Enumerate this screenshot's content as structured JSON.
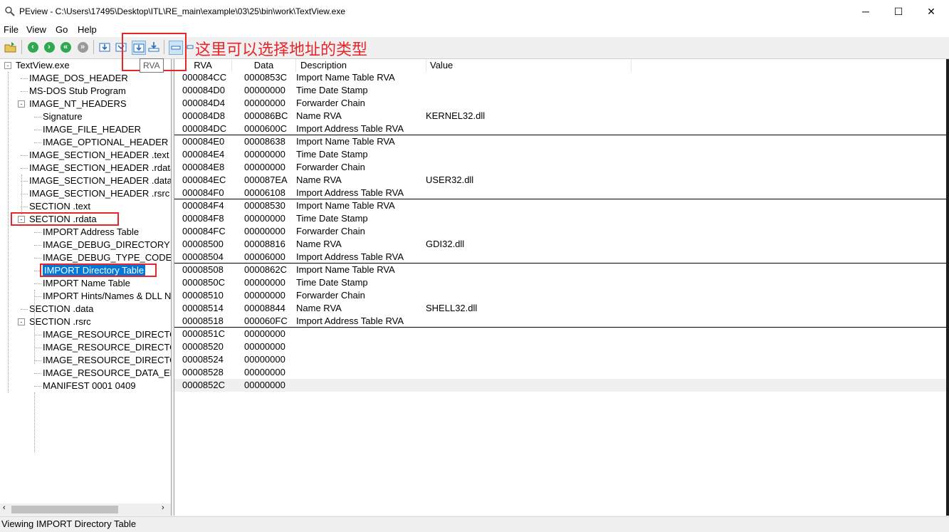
{
  "window": {
    "title": "PEview - C:\\Users\\17495\\Desktop\\ITL\\RE_main\\example\\03\\25\\bin\\work\\TextView.exe",
    "minimize": "─",
    "maximize": "☐",
    "close": "✕"
  },
  "menu": [
    "File",
    "View",
    "Go",
    "Help"
  ],
  "toolbar": {
    "tooltip": "RVA",
    "icons": [
      "open-file-icon",
      "back-icon",
      "forward-icon",
      "up-icon",
      "down-icon",
      "view-raw-icon",
      "view-rva-icon",
      "view-rva-selected-icon",
      "view-va-icon",
      "toolbar-option-icon"
    ]
  },
  "annotation": {
    "text": "这里可以选择地址的类型"
  },
  "tree": {
    "nodes": [
      {
        "label": "TextView.exe",
        "depth": 0,
        "expander": "-"
      },
      {
        "label": "IMAGE_DOS_HEADER",
        "depth": 1
      },
      {
        "label": "MS-DOS Stub Program",
        "depth": 1
      },
      {
        "label": "IMAGE_NT_HEADERS",
        "depth": 1,
        "expander": "-"
      },
      {
        "label": "Signature",
        "depth": 2
      },
      {
        "label": "IMAGE_FILE_HEADER",
        "depth": 2
      },
      {
        "label": "IMAGE_OPTIONAL_HEADER",
        "depth": 2
      },
      {
        "label": "IMAGE_SECTION_HEADER .text",
        "depth": 1
      },
      {
        "label": "IMAGE_SECTION_HEADER .rdata",
        "depth": 1
      },
      {
        "label": "IMAGE_SECTION_HEADER .data",
        "depth": 1
      },
      {
        "label": "IMAGE_SECTION_HEADER .rsrc",
        "depth": 1
      },
      {
        "label": "SECTION .text",
        "depth": 1
      },
      {
        "label": "SECTION .rdata",
        "depth": 1,
        "expander": "-"
      },
      {
        "label": "IMPORT Address Table",
        "depth": 2
      },
      {
        "label": "IMAGE_DEBUG_DIRECTORY",
        "depth": 2
      },
      {
        "label": "IMAGE_DEBUG_TYPE_CODEVIEW",
        "depth": 2
      },
      {
        "label": "IMPORT Directory Table",
        "depth": 2,
        "selected": true
      },
      {
        "label": "IMPORT Name Table",
        "depth": 2
      },
      {
        "label": "IMPORT Hints/Names & DLL Names",
        "depth": 2
      },
      {
        "label": "SECTION .data",
        "depth": 1
      },
      {
        "label": "SECTION .rsrc",
        "depth": 1,
        "expander": "-"
      },
      {
        "label": "IMAGE_RESOURCE_DIRECTORY Type",
        "depth": 2
      },
      {
        "label": "IMAGE_RESOURCE_DIRECTORY NameID",
        "depth": 2
      },
      {
        "label": "IMAGE_RESOURCE_DIRECTORY Language",
        "depth": 2
      },
      {
        "label": "IMAGE_RESOURCE_DATA_ENTRY",
        "depth": 2
      },
      {
        "label": "MANIFEST  0001  0409",
        "depth": 2
      }
    ]
  },
  "list": {
    "columns": [
      "RVA",
      "Data",
      "Description",
      "Value"
    ],
    "rows": [
      {
        "rva": "000084CC",
        "data": "0000853C",
        "desc": "Import Name Table RVA",
        "value": ""
      },
      {
        "rva": "000084D0",
        "data": "00000000",
        "desc": "Time Date Stamp",
        "value": ""
      },
      {
        "rva": "000084D4",
        "data": "00000000",
        "desc": "Forwarder Chain",
        "value": ""
      },
      {
        "rva": "000084D8",
        "data": "000086BC",
        "desc": "Name RVA",
        "value": "KERNEL32.dll"
      },
      {
        "rva": "000084DC",
        "data": "0000600C",
        "desc": "Import Address Table RVA",
        "value": "",
        "sep": true
      },
      {
        "rva": "000084E0",
        "data": "00008638",
        "desc": "Import Name Table RVA",
        "value": ""
      },
      {
        "rva": "000084E4",
        "data": "00000000",
        "desc": "Time Date Stamp",
        "value": ""
      },
      {
        "rva": "000084E8",
        "data": "00000000",
        "desc": "Forwarder Chain",
        "value": ""
      },
      {
        "rva": "000084EC",
        "data": "000087EA",
        "desc": "Name RVA",
        "value": "USER32.dll"
      },
      {
        "rva": "000084F0",
        "data": "00006108",
        "desc": "Import Address Table RVA",
        "value": "",
        "sep": true
      },
      {
        "rva": "000084F4",
        "data": "00008530",
        "desc": "Import Name Table RVA",
        "value": ""
      },
      {
        "rva": "000084F8",
        "data": "00000000",
        "desc": "Time Date Stamp",
        "value": ""
      },
      {
        "rva": "000084FC",
        "data": "00000000",
        "desc": "Forwarder Chain",
        "value": ""
      },
      {
        "rva": "00008500",
        "data": "00008816",
        "desc": "Name RVA",
        "value": "GDI32.dll"
      },
      {
        "rva": "00008504",
        "data": "00006000",
        "desc": "Import Address Table RVA",
        "value": "",
        "sep": true
      },
      {
        "rva": "00008508",
        "data": "0000862C",
        "desc": "Import Name Table RVA",
        "value": ""
      },
      {
        "rva": "0000850C",
        "data": "00000000",
        "desc": "Time Date Stamp",
        "value": ""
      },
      {
        "rva": "00008510",
        "data": "00000000",
        "desc": "Forwarder Chain",
        "value": ""
      },
      {
        "rva": "00008514",
        "data": "00008844",
        "desc": "Name RVA",
        "value": "SHELL32.dll"
      },
      {
        "rva": "00008518",
        "data": "000060FC",
        "desc": "Import Address Table RVA",
        "value": "",
        "sep": true
      },
      {
        "rva": "0000851C",
        "data": "00000000",
        "desc": "",
        "value": ""
      },
      {
        "rva": "00008520",
        "data": "00000000",
        "desc": "",
        "value": ""
      },
      {
        "rva": "00008524",
        "data": "00000000",
        "desc": "",
        "value": ""
      },
      {
        "rva": "00008528",
        "data": "00000000",
        "desc": "",
        "value": ""
      },
      {
        "rva": "0000852C",
        "data": "00000000",
        "desc": "",
        "value": "",
        "highlighted": true
      }
    ]
  },
  "status": "Viewing IMPORT Directory Table"
}
